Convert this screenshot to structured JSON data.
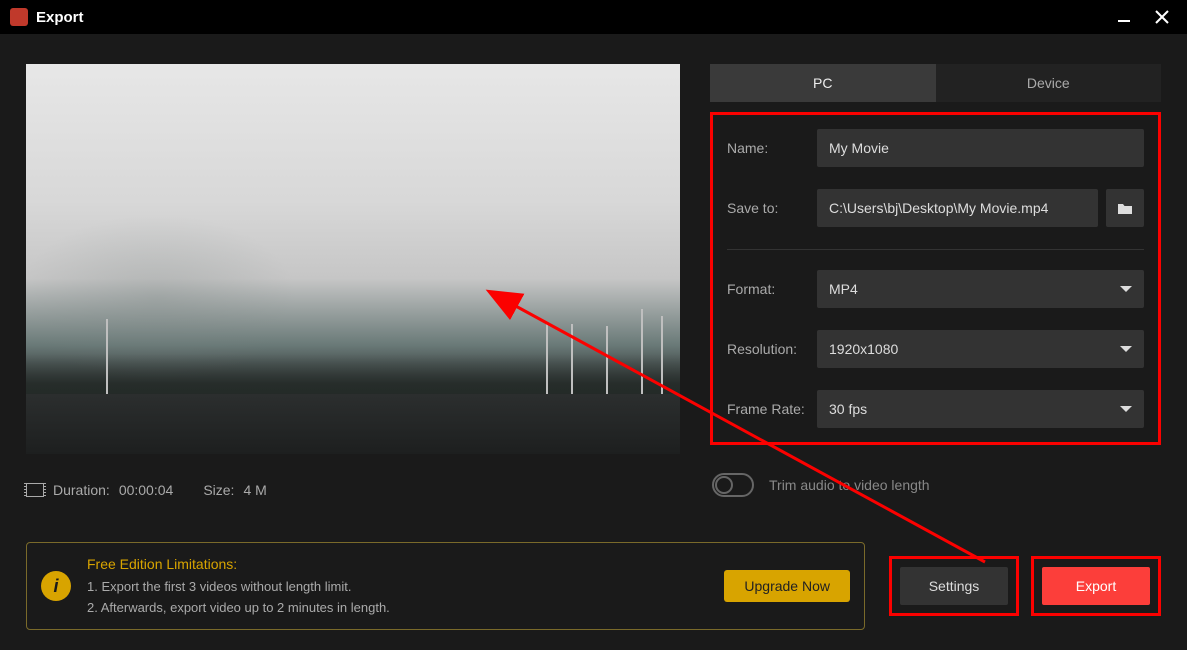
{
  "window": {
    "title": "Export"
  },
  "tabs": {
    "pc": "PC",
    "device": "Device"
  },
  "form": {
    "name_label": "Name:",
    "name_value": "My Movie",
    "save_label": "Save to:",
    "save_value": "C:\\Users\\bj\\Desktop\\My Movie.mp4",
    "format_label": "Format:",
    "format_value": "MP4",
    "resolution_label": "Resolution:",
    "resolution_value": "1920x1080",
    "framerate_label": "Frame Rate:",
    "framerate_value": "30 fps"
  },
  "trim": {
    "label": "Trim audio to video length"
  },
  "stats": {
    "duration_label": "Duration:",
    "duration_value": "00:00:04",
    "size_label": "Size:",
    "size_value": "4 M"
  },
  "limitations": {
    "title": "Free Edition Limitations:",
    "line1": "1. Export the first 3 videos without length limit.",
    "line2": "2. Afterwards, export video up to 2 minutes in length.",
    "upgrade": "Upgrade Now"
  },
  "actions": {
    "settings": "Settings",
    "export": "Export"
  }
}
